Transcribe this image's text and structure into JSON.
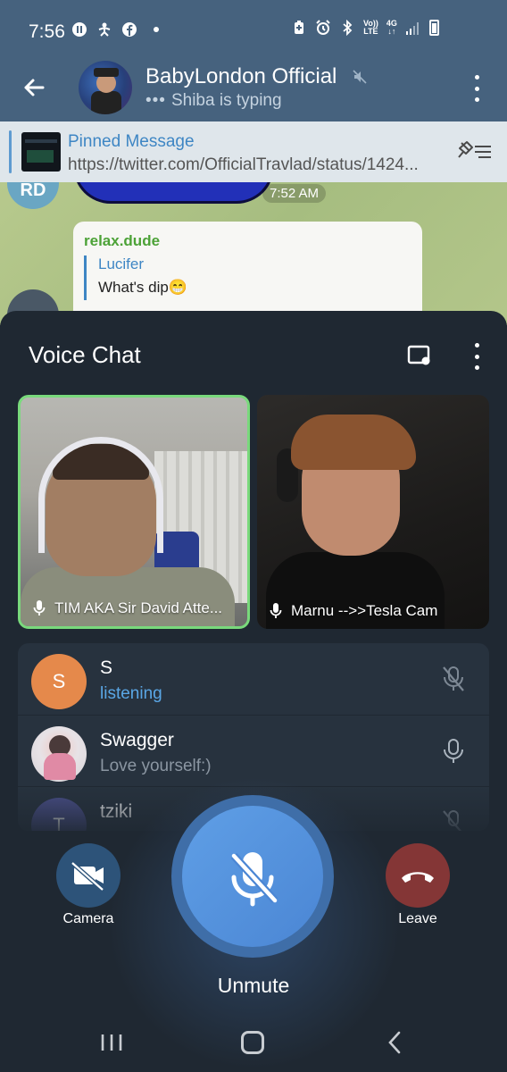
{
  "status_bar": {
    "time": "7:56",
    "lte_top": "Vo))",
    "lte_bottom": "LTE",
    "net_top": "4G",
    "net_bottom": "↓↑"
  },
  "chat_header": {
    "title": "BabyLondon Official",
    "typing_dots": "•••",
    "subtitle": "Shiba is typing"
  },
  "pinned": {
    "title": "Pinned Message",
    "text": "https://twitter.com/OfficialTravlad/status/1424..."
  },
  "chat": {
    "avatar_initials": "RD",
    "time": "7:52 AM",
    "message": {
      "sender": "relax.dude",
      "reply_name": "Lucifer",
      "reply_text": "What's dip😁"
    }
  },
  "voice_chat": {
    "title": "Voice Chat",
    "videos": [
      {
        "name": "TIM AKA Sir David Atte..."
      },
      {
        "name": "Marnu -->>Tesla Cam"
      }
    ],
    "participants": [
      {
        "initial": "S",
        "name": "S",
        "status": "listening",
        "avatar_color": "#e5894b",
        "status_color": "#5aa7e6"
      },
      {
        "initial": "",
        "name": "Swagger",
        "status": "Love yourself:)",
        "avatar_color": "#e9e4e8",
        "status_color": "#8b96a2"
      },
      {
        "initial": "T",
        "name": "tziki",
        "status": "",
        "avatar_color": "#4a4f8a",
        "status_color": "#8b96a2"
      }
    ],
    "controls": {
      "camera_label": "Camera",
      "unmute_label": "Unmute",
      "leave_label": "Leave"
    }
  },
  "colors": {
    "header": "#46627e",
    "sheet": "#1f2832",
    "accent": "#4b86d4",
    "speaking_border": "#79d97c",
    "leave": "#843636"
  }
}
